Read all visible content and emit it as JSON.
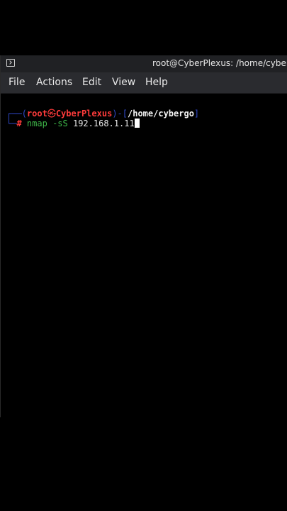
{
  "window": {
    "title": "root@CyberPlexus: /home/cybergo",
    "icon": "terminal-icon"
  },
  "menu": {
    "items": [
      "File",
      "Actions",
      "Edit",
      "View",
      "Help"
    ]
  },
  "terminal": {
    "prompt": {
      "user": "root",
      "separator_icon": "skull-icon",
      "separator_glyph": "㉿",
      "host": "CyberPlexus",
      "path": "/home/cybergo",
      "symbol": "#"
    },
    "command": {
      "program": "nmap",
      "flag": "-sS",
      "target": "192.168.1.11"
    }
  },
  "colors": {
    "prompt_box": "#2f49c9",
    "user_host": "#ff3b3b",
    "command": "#3fb84a",
    "menubar": "#2a2b2f",
    "titlebar": "#202124"
  }
}
